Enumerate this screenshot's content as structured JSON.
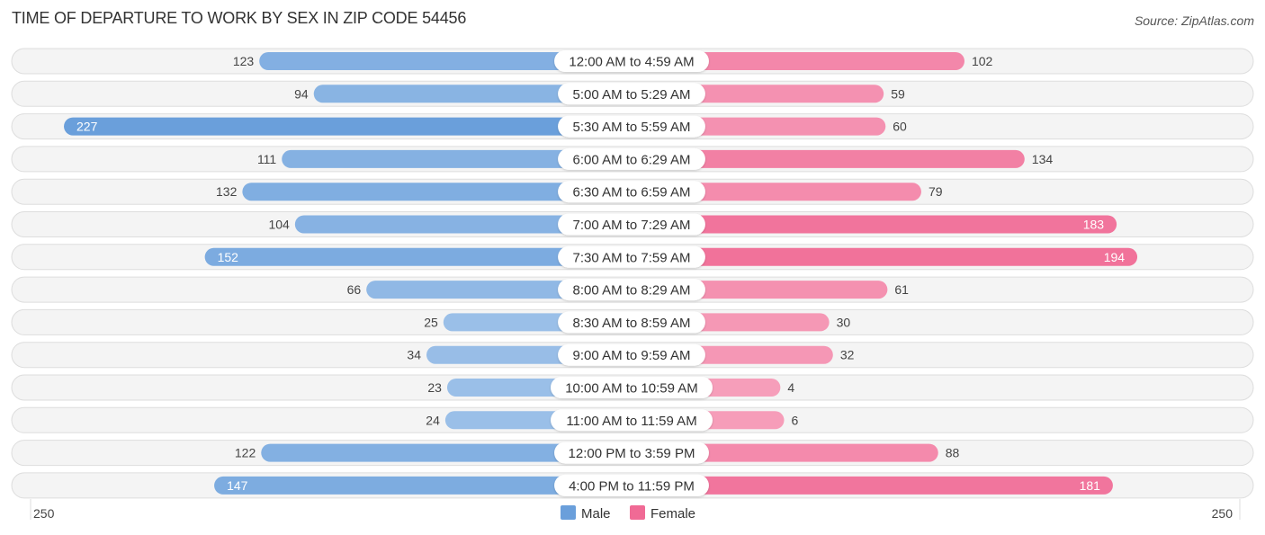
{
  "header": {
    "title": "TIME OF DEPARTURE TO WORK BY SEX IN ZIP CODE 54456",
    "source": "Source: ZipAtlas.com"
  },
  "colors": {
    "male": "#6a9fdb",
    "male_light": "#a9c9ec",
    "female": "#f06a95",
    "female_light": "#f7a8c1"
  },
  "chart_data": {
    "type": "bar",
    "orientation": "horizontal-diverging",
    "title": "TIME OF DEPARTURE TO WORK BY SEX IN ZIP CODE 54456",
    "categories": [
      "12:00 AM to 4:59 AM",
      "5:00 AM to 5:29 AM",
      "5:30 AM to 5:59 AM",
      "6:00 AM to 6:29 AM",
      "6:30 AM to 6:59 AM",
      "7:00 AM to 7:29 AM",
      "7:30 AM to 7:59 AM",
      "8:00 AM to 8:29 AM",
      "8:30 AM to 8:59 AM",
      "9:00 AM to 9:59 AM",
      "10:00 AM to 10:59 AM",
      "11:00 AM to 11:59 AM",
      "12:00 PM to 3:59 PM",
      "4:00 PM to 11:59 PM"
    ],
    "series": [
      {
        "name": "Male",
        "values": [
          123,
          94,
          227,
          111,
          132,
          104,
          152,
          66,
          25,
          34,
          23,
          24,
          122,
          147
        ]
      },
      {
        "name": "Female",
        "values": [
          102,
          59,
          60,
          134,
          79,
          183,
          194,
          61,
          30,
          32,
          4,
          6,
          88,
          181
        ]
      }
    ],
    "xlim": [
      -250,
      250
    ],
    "axis_ticks": {
      "left": "250",
      "right": "250"
    },
    "legend": {
      "position": "bottom-center",
      "entries": [
        "Male",
        "Female"
      ]
    },
    "grid": false
  }
}
